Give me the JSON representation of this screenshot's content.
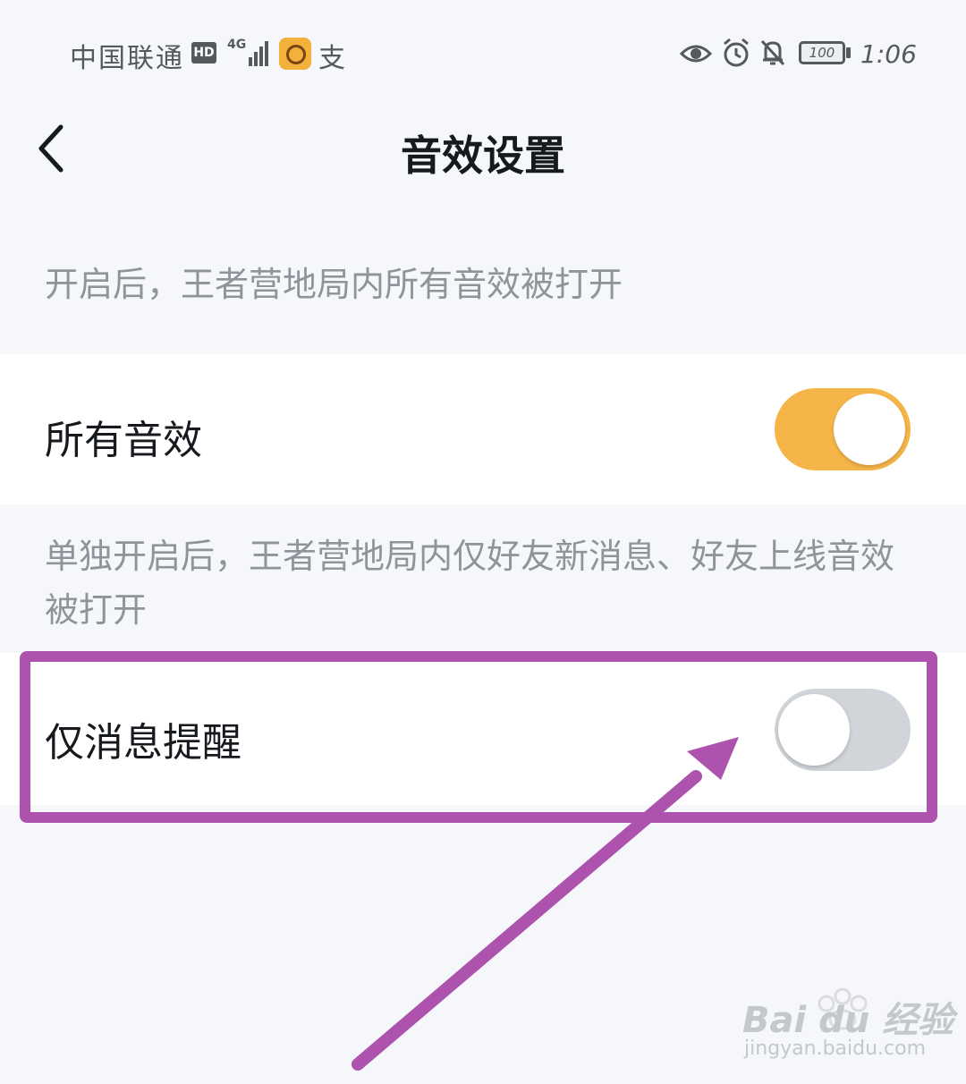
{
  "status_bar": {
    "carrier": "中国联通",
    "hd": "HD",
    "network": "4G",
    "app_char": "支",
    "battery": "100",
    "time": "1:06"
  },
  "header": {
    "title": "音效设置"
  },
  "sections": {
    "all_sound_desc": "开启后，王者营地局内所有音效被打开",
    "all_sound_label": "所有音效",
    "all_sound_on": true,
    "msg_only_desc": "单独开启后，王者营地局内仅好友新消息、好友上线音效被打开",
    "msg_only_label": "仅消息提醒",
    "msg_only_on": false
  },
  "colors": {
    "toggle_on": "#f6b549",
    "toggle_off": "#d1d5da",
    "annotation": "#ad52ad"
  },
  "watermark": {
    "brand": "Bai du 经验",
    "url": "jingyan.baidu.com"
  }
}
